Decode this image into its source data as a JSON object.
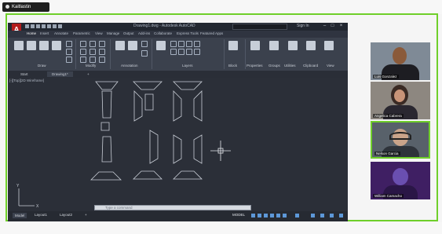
{
  "share_indicator": {
    "label": "Kaitlastin"
  },
  "cad": {
    "app_logo": "A",
    "title": "Drawing1.dwg - Autodesk AutoCAD",
    "search_placeholder": "Type a keyword or phrase",
    "signin_label": "Sign In",
    "tabs": [
      "Home",
      "Insert",
      "Annotate",
      "Parametric",
      "View",
      "Manage",
      "Output",
      "Add-ins",
      "Collaborate",
      "Express Tools",
      "Featured Apps"
    ],
    "panels": [
      "Draw",
      "Modify",
      "Annotation",
      "Layers",
      "Block",
      "Properties",
      "Groups",
      "Utilities",
      "Clipboard",
      "View"
    ],
    "file_tabs": [
      "Start",
      "Drawing1*"
    ],
    "viewport_label": "[-][Top][2D Wireframe]",
    "command_placeholder": "Type a command",
    "layout_tabs": [
      "Model",
      "Layout1",
      "Layout2"
    ],
    "model_label": "MODEL",
    "display_digits": "150",
    "ucs_labels": {
      "y": "Y",
      "x": "X"
    }
  },
  "participants": [
    {
      "name": "Luis Gonzalez"
    },
    {
      "name": "Angelica Cabrera"
    },
    {
      "name": "Nelson Garcia"
    },
    {
      "name": "William Camacho"
    }
  ],
  "colors": {
    "share_border": "#6fcf2a",
    "autocad_red": "#b31b1b",
    "canvas": "#2b2f38"
  }
}
